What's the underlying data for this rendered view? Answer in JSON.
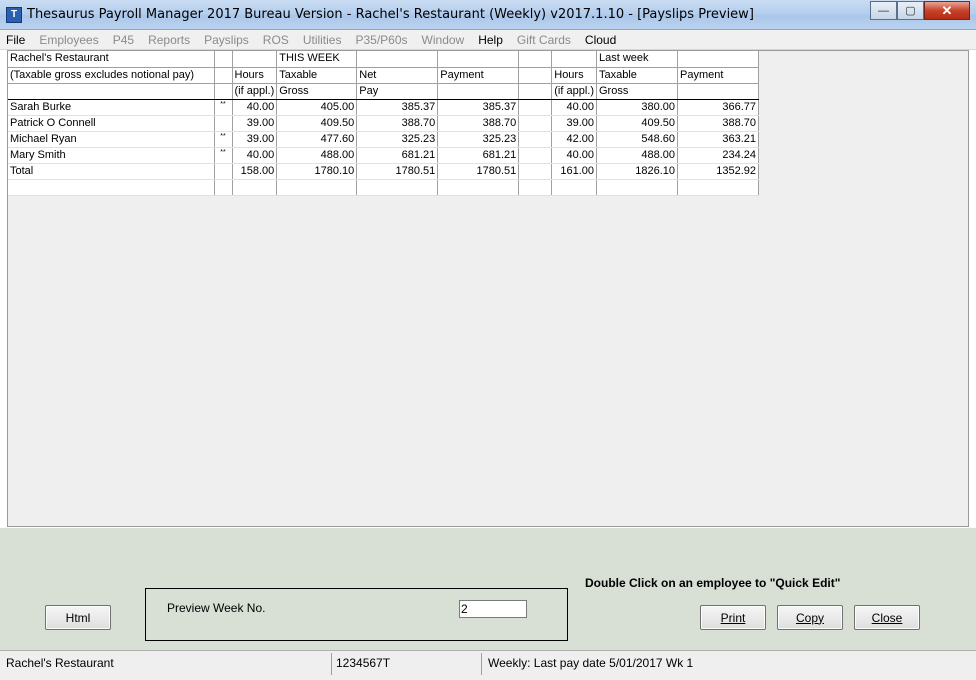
{
  "window": {
    "title": "Thesaurus Payroll Manager 2017 Bureau Version - Rachel's Restaurant (Weekly)      v2017.1.10 - [Payslips Preview]",
    "icon": "app-icon",
    "controls": {
      "minimize": "—",
      "maximize": "▢",
      "close": "✕"
    }
  },
  "menu": [
    {
      "label": "File",
      "enabled": true
    },
    {
      "label": "Employees",
      "enabled": false
    },
    {
      "label": "P45",
      "enabled": false
    },
    {
      "label": "Reports",
      "enabled": false
    },
    {
      "label": "Payslips",
      "enabled": false
    },
    {
      "label": "ROS",
      "enabled": false
    },
    {
      "label": "Utilities",
      "enabled": false
    },
    {
      "label": "P35/P60s",
      "enabled": false
    },
    {
      "label": "Window",
      "enabled": false
    },
    {
      "label": "Help",
      "enabled": true
    },
    {
      "label": "Gift Cards",
      "enabled": false
    },
    {
      "label": "Cloud",
      "enabled": true
    }
  ],
  "grid": {
    "header_rows": [
      [
        "Rachel's Restaurant",
        "",
        "",
        "THIS WEEK",
        "",
        "",
        "",
        "",
        "Last week",
        ""
      ],
      [
        "(Taxable gross excludes notional pay)",
        "",
        "Hours",
        "Taxable",
        "Net",
        "Payment",
        "",
        "Hours",
        "Taxable",
        "Payment"
      ],
      [
        "",
        "",
        "(if appl.)",
        "Gross",
        "Pay",
        "",
        "",
        "(if appl.)",
        "Gross",
        ""
      ]
    ],
    "rows": [
      [
        "Sarah Burke",
        "**",
        "40.00",
        "405.00",
        "385.37",
        "385.37",
        "",
        "40.00",
        "380.00",
        "366.77"
      ],
      [
        "Patrick O Connell",
        "",
        "39.00",
        "409.50",
        "388.70",
        "388.70",
        "",
        "39.00",
        "409.50",
        "388.70"
      ],
      [
        "Michael Ryan",
        "**",
        "39.00",
        "477.60",
        "325.23",
        "325.23",
        "",
        "42.00",
        "548.60",
        "363.21"
      ],
      [
        "Mary Smith",
        "**",
        "40.00",
        "488.00",
        "681.21",
        "681.21",
        "",
        "40.00",
        "488.00",
        "234.24"
      ],
      [
        "Total",
        "",
        "158.00",
        "1780.10",
        "1780.51",
        "1780.51",
        "",
        "161.00",
        "1826.10",
        "1352.92"
      ],
      [
        "",
        "",
        "",
        "",
        "",
        "",
        "",
        "",
        "",
        ""
      ]
    ]
  },
  "buttons": {
    "html": "Html",
    "print": "Print",
    "copy": "Copy",
    "close": "Close"
  },
  "preview": {
    "label": "Preview Week No.",
    "week_value": "2"
  },
  "hint": "Double Click on an employee to \"Quick Edit\"",
  "status": {
    "company": "Rachel's Restaurant",
    "employer_no": "1234567T",
    "pay_info": "Weekly: Last pay date 5/01/2017 Wk 1"
  }
}
